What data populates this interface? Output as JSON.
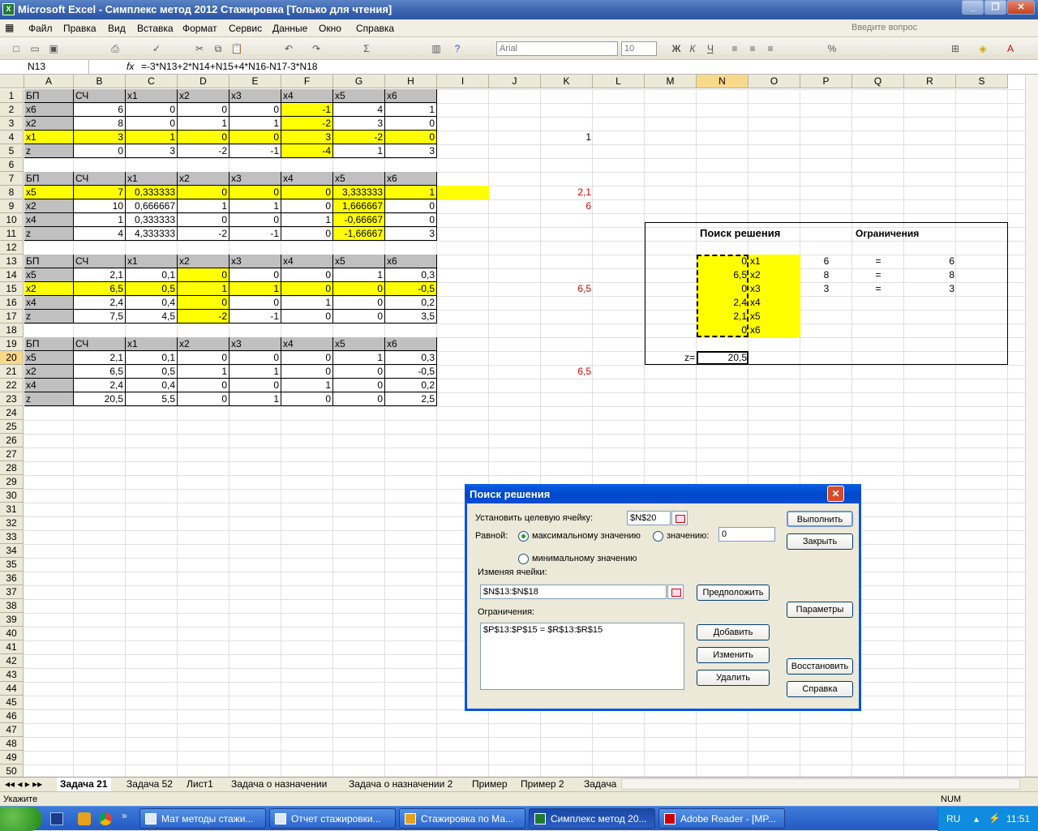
{
  "window": {
    "title": "Microsoft Excel - Симплекс метод 2012 Стажировка  [Только для чтения]"
  },
  "menu": {
    "items": [
      "Файл",
      "Правка",
      "Вид",
      "Вставка",
      "Формат",
      "Сервис",
      "Данные",
      "Окно",
      "Справка"
    ],
    "help_placeholder": "Введите вопрос"
  },
  "toolbar": {
    "font": "Arial",
    "size": "10"
  },
  "formula_bar": {
    "name": "N13",
    "fx": "fx",
    "formula": "=-3*N13+2*N14+N15+4*N16-N17-3*N18"
  },
  "columns": [
    "A",
    "B",
    "C",
    "D",
    "E",
    "F",
    "G",
    "H",
    "I",
    "J",
    "K",
    "L",
    "M",
    "N",
    "O",
    "P",
    "Q",
    "R",
    "S"
  ],
  "rows": [
    "1",
    "2",
    "3",
    "4",
    "5",
    "6",
    "7",
    "8",
    "9",
    "10",
    "11",
    "12",
    "13",
    "14",
    "15",
    "16",
    "17",
    "18",
    "19",
    "20",
    "21",
    "22",
    "23",
    "24",
    "25",
    "26",
    "27",
    "28",
    "29",
    "30",
    "31",
    "32",
    "33",
    "34",
    "35",
    "36",
    "37",
    "38",
    "39",
    "40",
    "41",
    "42",
    "43",
    "44",
    "45",
    "46",
    "47",
    "48",
    "49",
    "50"
  ],
  "sheet": {
    "t1": [
      [
        "БП",
        "СЧ",
        "x1",
        "x2",
        "x3",
        "x4",
        "x5",
        "x6"
      ],
      [
        "x6",
        "6",
        "0",
        "0",
        "0",
        "-1",
        "4",
        "1"
      ],
      [
        "x2",
        "8",
        "0",
        "1",
        "1",
        "-2",
        "3",
        "0"
      ],
      [
        "x1",
        "3",
        "1",
        "0",
        "0",
        "3",
        "-2",
        "0"
      ],
      [
        "z",
        "0",
        "3",
        "-2",
        "-1",
        "-4",
        "1",
        "3"
      ]
    ],
    "t2": [
      [
        "БП",
        "СЧ",
        "x1",
        "x2",
        "x3",
        "x4",
        "x5",
        "x6"
      ],
      [
        "x5",
        "7",
        "0,333333",
        "0",
        "0",
        "0",
        "3,333333",
        "1"
      ],
      [
        "x2",
        "10",
        "0,666667",
        "1",
        "1",
        "0",
        "1,666667",
        "0"
      ],
      [
        "x4",
        "1",
        "0,333333",
        "0",
        "0",
        "1",
        "-0,66667",
        "0"
      ],
      [
        "z",
        "4",
        "4,333333",
        "-2",
        "-1",
        "0",
        "-1,66667",
        "3"
      ]
    ],
    "t3": [
      [
        "БП",
        "СЧ",
        "x1",
        "x2",
        "x3",
        "x4",
        "x5",
        "x6"
      ],
      [
        "x5",
        "2,1",
        "0,1",
        "0",
        "0",
        "0",
        "1",
        "0,3"
      ],
      [
        "x2",
        "6,5",
        "0,5",
        "1",
        "1",
        "0",
        "0",
        "-0,5"
      ],
      [
        "x4",
        "2,4",
        "0,4",
        "0",
        "0",
        "1",
        "0",
        "0,2"
      ],
      [
        "z",
        "7,5",
        "4,5",
        "-2",
        "-1",
        "0",
        "0",
        "3,5"
      ]
    ],
    "t4": [
      [
        "БП",
        "СЧ",
        "x1",
        "x2",
        "x3",
        "x4",
        "x5",
        "x6"
      ],
      [
        "x5",
        "2,1",
        "0,1",
        "0",
        "0",
        "0",
        "1",
        "0,3"
      ],
      [
        "x2",
        "6,5",
        "0,5",
        "1",
        "1",
        "0",
        "0",
        "-0,5"
      ],
      [
        "x4",
        "2,4",
        "0,4",
        "0",
        "0",
        "1",
        "0",
        "0,2"
      ],
      [
        "z",
        "20,5",
        "5,5",
        "0",
        "1",
        "0",
        "0",
        "2,5"
      ]
    ],
    "k": {
      "k4": "1",
      "k8": "2,1",
      "k9": "6",
      "k15": "6,5",
      "k21": "6,5"
    },
    "solver_box": {
      "title": "Поиск решения",
      "limits": "Ограничения",
      "n_values": [
        "0",
        "6,5",
        "0",
        "2,4",
        "2,1",
        "0"
      ],
      "x_names": [
        "x1",
        "x2",
        "x3",
        "x4",
        "x5",
        "x6"
      ],
      "p_values": [
        "6",
        "8",
        "3"
      ],
      "eq": "=",
      "r_values": [
        "6",
        "8",
        "3"
      ],
      "z_label": "z=",
      "z_value": "20,5"
    }
  },
  "sheet_tabs": [
    "Задача 21",
    "Задача 52",
    "Лист1",
    "Задача о назначении",
    "Задача о назначении 2",
    "Пример",
    "Пример 2",
    "Задача"
  ],
  "status": {
    "mode": "Укажите",
    "num": "NUM"
  },
  "taskbar": {
    "items": [
      "Мат методы стажи...",
      "Отчет стажировки...",
      "Стажировка по Ма...",
      "Симплекс метод 20...",
      "Adobe Reader - [MP..."
    ],
    "lang": "RU",
    "time": "11:51"
  },
  "dialog": {
    "title": "Поиск решения",
    "target_label": "Установить целевую ячейку:",
    "target_value": "$N$20",
    "equal_label": "Равной:",
    "max_label": "максимальному значению",
    "value_label": "значению:",
    "value_input": "0",
    "min_label": "минимальному значению",
    "changing_label": "Изменяя ячейки:",
    "changing_value": "$N$13:$N$18",
    "guess": "Предположить",
    "constraints_label": "Ограничения:",
    "constraint": "$P$13:$P$15 = $R$13:$R$15",
    "add": "Добавить",
    "change": "Изменить",
    "delete": "Удалить",
    "execute": "Выполнить",
    "close": "Закрыть",
    "options": "Параметры",
    "reset": "Восстановить",
    "help": "Справка"
  }
}
